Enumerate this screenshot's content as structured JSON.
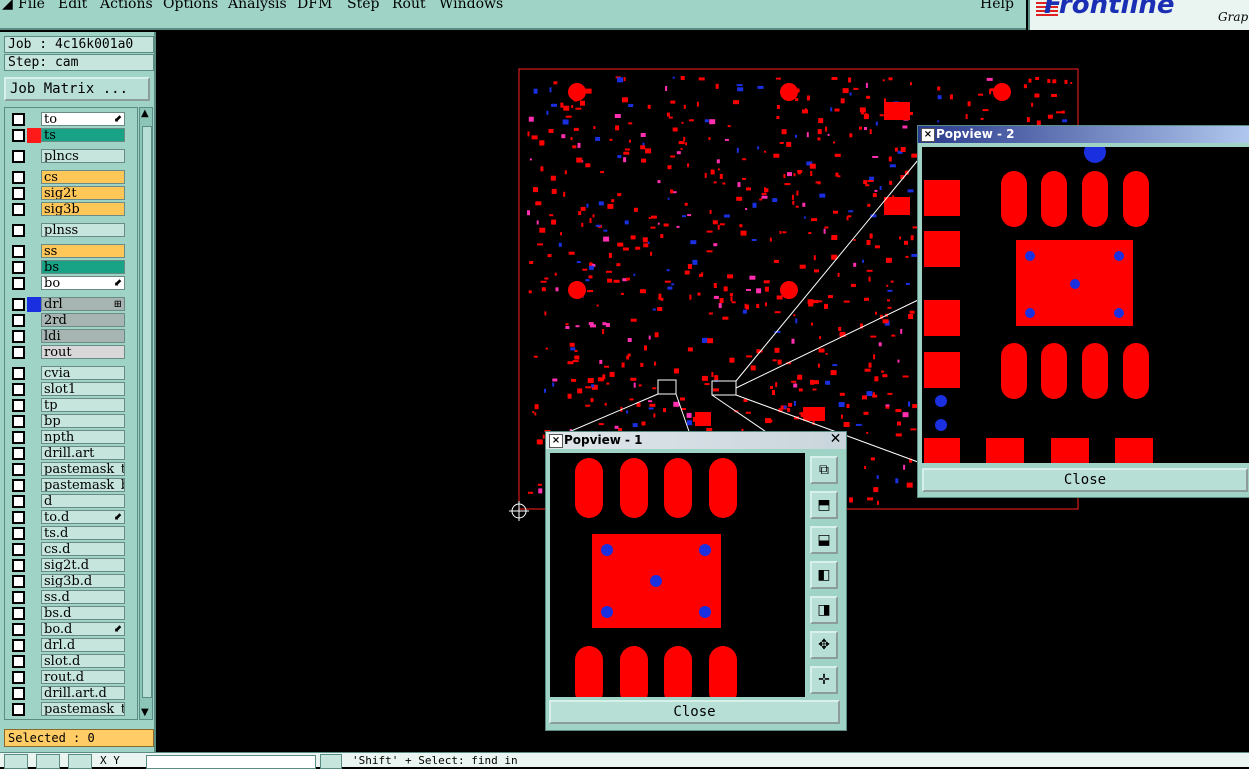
{
  "menu": {
    "items": [
      "File",
      "Edit",
      "Actions",
      "Options",
      "Analysis",
      "DFM",
      "Step",
      "Rout",
      "Windows"
    ],
    "help": "Help"
  },
  "logo": {
    "name": "Frontline",
    "sub": "Grap"
  },
  "job": {
    "job_label": "Job : 4c16k001a0",
    "step_label": "Step: cam",
    "matrix_button": "Job Matrix ..."
  },
  "layers": [
    {
      "name": "to",
      "color": "#ffffff",
      "dot": "",
      "mark": "⬋"
    },
    {
      "name": "ts",
      "color": "#19a386",
      "dot": "#ff1a1a",
      "mark": ""
    },
    {
      "name": "plncs",
      "color": "#c6e6dd",
      "dot": "",
      "mark": ""
    },
    {
      "name": "cs",
      "color": "#ffc658",
      "dot": "",
      "mark": ""
    },
    {
      "name": "sig2t",
      "color": "#ffc658",
      "dot": "",
      "mark": ""
    },
    {
      "name": "sig3b",
      "color": "#ffc658",
      "dot": "",
      "mark": ""
    },
    {
      "name": "plnss",
      "color": "#c6e6dd",
      "dot": "",
      "mark": ""
    },
    {
      "name": "ss",
      "color": "#ffc658",
      "dot": "",
      "mark": ""
    },
    {
      "name": "bs",
      "color": "#19a386",
      "dot": "",
      "mark": ""
    },
    {
      "name": "bo",
      "color": "#ffffff",
      "dot": "",
      "mark": "⬋"
    },
    {
      "name": "drl",
      "color": "#a6b4b2",
      "dot": "#1a2fe0",
      "mark": "⊞"
    },
    {
      "name": "2rd",
      "color": "#a6b4b2",
      "dot": "",
      "mark": ""
    },
    {
      "name": "ldi",
      "color": "#a6b4b2",
      "dot": "",
      "mark": ""
    },
    {
      "name": "rout",
      "color": "#d8d8d8",
      "dot": "",
      "mark": ""
    },
    {
      "name": "cvia",
      "color": "#c6e6dd",
      "dot": "",
      "mark": ""
    },
    {
      "name": "slot1",
      "color": "#c6e6dd",
      "dot": "",
      "mark": ""
    },
    {
      "name": "tp",
      "color": "#c6e6dd",
      "dot": "",
      "mark": ""
    },
    {
      "name": "bp",
      "color": "#c6e6dd",
      "dot": "",
      "mark": ""
    },
    {
      "name": "npth",
      "color": "#c6e6dd",
      "dot": "",
      "mark": ""
    },
    {
      "name": "drill.art",
      "color": "#c6e6dd",
      "dot": "",
      "mark": ""
    },
    {
      "name": "pastemask_to",
      "color": "#c6e6dd",
      "dot": "",
      "mark": ""
    },
    {
      "name": "pastemask_bo",
      "color": "#c6e6dd",
      "dot": "",
      "mark": ""
    },
    {
      "name": "d",
      "color": "#c6e6dd",
      "dot": "",
      "mark": ""
    },
    {
      "name": "to.d",
      "color": "#c6e6dd",
      "dot": "",
      "mark": "⬋"
    },
    {
      "name": "ts.d",
      "color": "#c6e6dd",
      "dot": "",
      "mark": ""
    },
    {
      "name": "cs.d",
      "color": "#c6e6dd",
      "dot": "",
      "mark": ""
    },
    {
      "name": "sig2t.d",
      "color": "#c6e6dd",
      "dot": "",
      "mark": ""
    },
    {
      "name": "sig3b.d",
      "color": "#c6e6dd",
      "dot": "",
      "mark": ""
    },
    {
      "name": "ss.d",
      "color": "#c6e6dd",
      "dot": "",
      "mark": ""
    },
    {
      "name": "bs.d",
      "color": "#c6e6dd",
      "dot": "",
      "mark": ""
    },
    {
      "name": "bo.d",
      "color": "#c6e6dd",
      "dot": "",
      "mark": "⬋"
    },
    {
      "name": "drl.d",
      "color": "#c6e6dd",
      "dot": "",
      "mark": ""
    },
    {
      "name": "slot.d",
      "color": "#c6e6dd",
      "dot": "",
      "mark": ""
    },
    {
      "name": "rout.d",
      "color": "#c6e6dd",
      "dot": "",
      "mark": ""
    },
    {
      "name": "drill.art.d",
      "color": "#c6e6dd",
      "dot": "",
      "mark": ""
    },
    {
      "name": "pastemask_to",
      "color": "#c6e6dd",
      "dot": "",
      "mark": ""
    }
  ],
  "selected_label": "Selected : 0",
  "popview1": {
    "title": "Popview - 1",
    "close": "Close"
  },
  "popview2": {
    "title": "Popview - 2",
    "close": "Close"
  },
  "status": {
    "xy_label": "X Y",
    "text": "'Shift' + Select: find in"
  },
  "colors": {
    "copper": "#ff0000",
    "drill": "#1a2fe0",
    "panel": "#9fd3c6"
  }
}
